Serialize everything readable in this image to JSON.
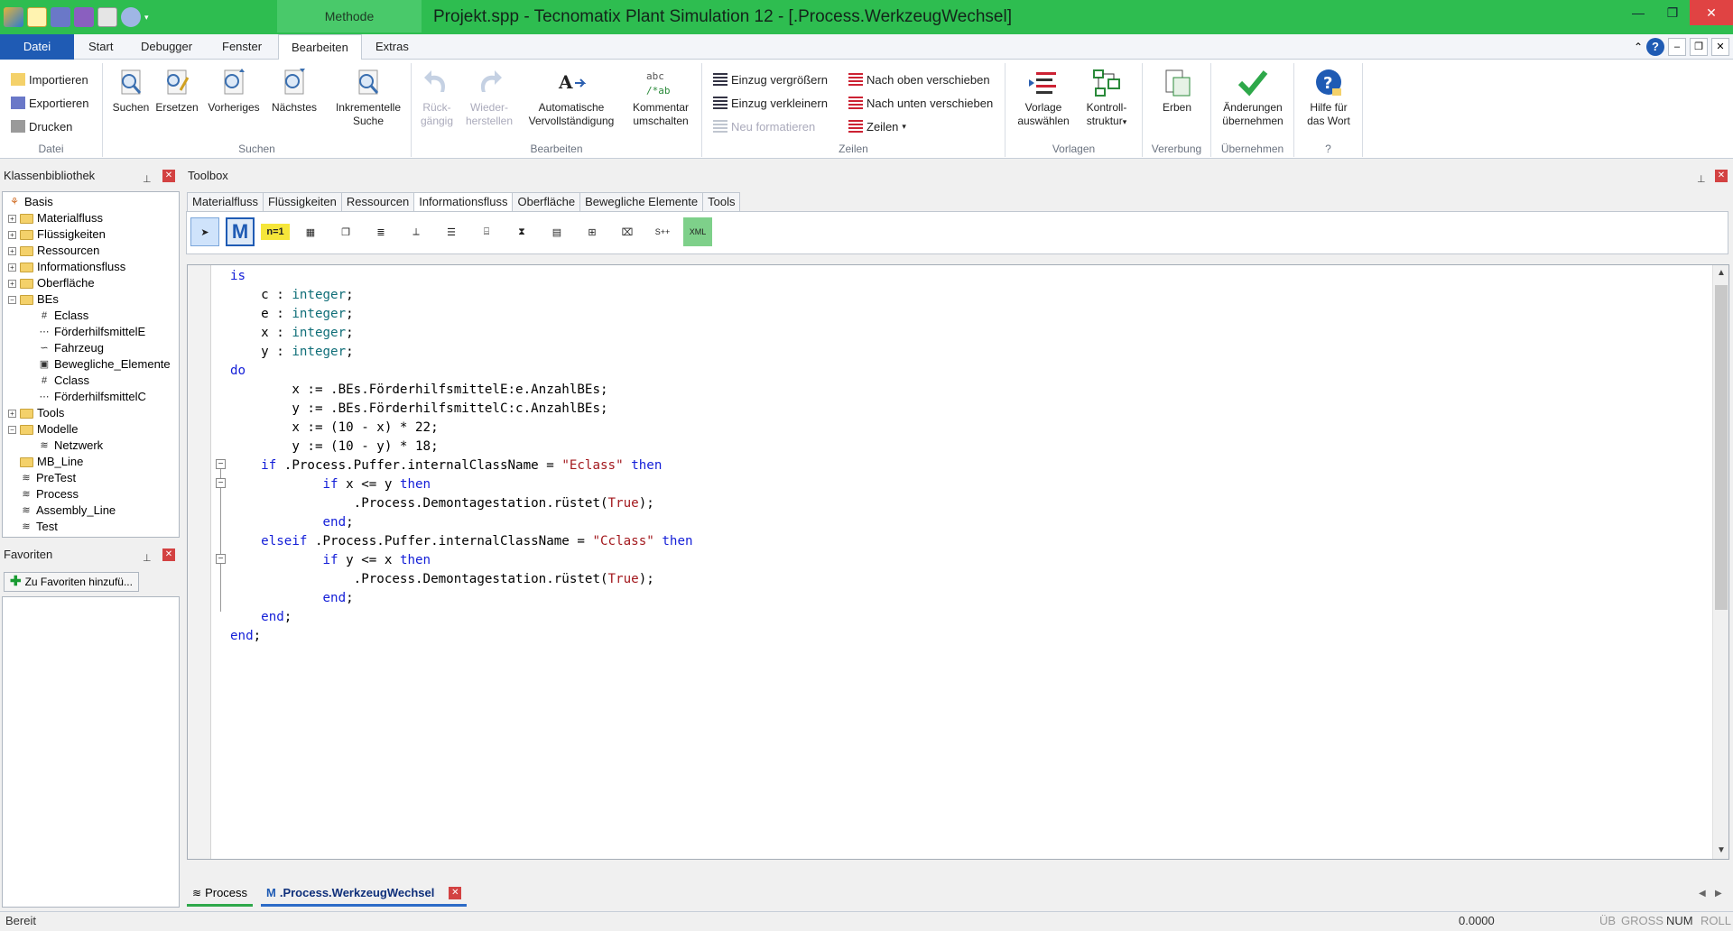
{
  "window": {
    "title": "Projekt.spp - Tecnomatix Plant Simulation 12 - [.Process.WerkzeugWechsel]",
    "contextual_tab": "Methode"
  },
  "ribbon_tabs": [
    "Datei",
    "Start",
    "Debugger",
    "Fenster",
    "Bearbeiten",
    "Extras"
  ],
  "active_tab": "Bearbeiten",
  "groups": {
    "datei": {
      "label": "Datei",
      "items": [
        "Importieren",
        "Exportieren",
        "Drucken"
      ]
    },
    "suchen": {
      "label": "Suchen",
      "items": [
        "Suchen",
        "Ersetzen",
        "Vorheriges",
        "Nächstes"
      ],
      "inkrementelle_1": "Inkrementelle",
      "inkrementelle_2": "Suche"
    },
    "bearbeiten": {
      "label": "Bearbeiten",
      "undo_1": "Rück-",
      "undo_2": "gängig",
      "redo_1": "Wieder-",
      "redo_2": "herstellen",
      "auto_1": "Automatische",
      "auto_2": "Vervollständigung",
      "comment_1": "Kommentar",
      "comment_2": "umschalten",
      "comment_icon_1": "abc",
      "comment_icon_2": "/*ab"
    },
    "zeilen": {
      "label": "Zeilen",
      "einzug_gross": "Einzug vergrößern",
      "einzug_klein": "Einzug verkleinern",
      "neu_format": "Neu formatieren",
      "nach_oben": "Nach oben verschieben",
      "nach_unten": "Nach unten verschieben",
      "zeilen_menu": "Zeilen"
    },
    "vorlagen": {
      "label": "Vorlagen",
      "vorlage_1": "Vorlage",
      "vorlage_2": "auswählen",
      "kontroll_1": "Kontroll-",
      "kontroll_2": "struktur"
    },
    "vererbung": {
      "label": "Vererbung",
      "erben": "Erben"
    },
    "uebernehmen": {
      "label": "Übernehmen",
      "aend_1": "Änderungen",
      "aend_2": "übernehmen"
    },
    "hilfe": {
      "label": "?",
      "hilfe_1": "Hilfe für",
      "hilfe_2": "das Wort"
    }
  },
  "classlib": {
    "title": "Klassenbibliothek",
    "nodes": [
      "Basis",
      "Materialfluss",
      "Flüssigkeiten",
      "Ressourcen",
      "Informationsfluss",
      "Oberfläche",
      "BEs",
      "Eclass",
      "FörderhilfsmittelE",
      "Fahrzeug",
      "Bewegliche_Elemente",
      "Cclass",
      "FörderhilfsmittelC",
      "Tools",
      "Modelle",
      "Netzwerk",
      "MB_Line",
      "PreTest",
      "Process",
      "Assembly_Line",
      "Test"
    ]
  },
  "favorites": {
    "title": "Favoriten",
    "add_button": "Zu Favoriten hinzufü..."
  },
  "toolbox": {
    "title": "Toolbox",
    "tabs": [
      "Materialfluss",
      "Flüssigkeiten",
      "Ressourcen",
      "Informationsfluss",
      "Oberfläche",
      "Bewegliche Elemente",
      "Tools"
    ],
    "active_tab": "Informationsfluss",
    "icons": [
      "pointer-icon",
      "method-icon",
      "variable-icon",
      "table-icon",
      "stack-table-icon",
      "queue-icon",
      "trigger-icon",
      "list-icon",
      "chart-icon",
      "generator-icon",
      "interface-icon",
      "dde-icon",
      "socket-icon",
      "sql-icon",
      "xml-icon"
    ],
    "icon_text": {
      "method": "M",
      "variable": "n=1"
    }
  },
  "code": [
    "is",
    "    c : integer;",
    "    e : integer;",
    "    x : integer;",
    "    y : integer;",
    "do",
    "        x := .BEs.FörderhilfsmittelE:e.AnzahlBEs;",
    "        y := .BEs.FörderhilfsmittelC:c.AnzahlBEs;",
    "        x := (10 - x) * 22;",
    "        y := (10 - y) * 18;",
    "    if .Process.Puffer.internalClassName = \"Eclass\" then",
    "            if x <= y then",
    "                .Process.Demontagestation.rüstet(True);",
    "            end;",
    "    elseif .Process.Puffer.internalClassName = \"Cclass\" then",
    "            if y <= x then",
    "                .Process.Demontagestation.rüstet(True);",
    "            end;",
    "    end;",
    "end;"
  ],
  "doc_tabs": [
    {
      "label": "Process",
      "active": false
    },
    {
      "label": ".Process.WerkzeugWechsel",
      "active": true
    }
  ],
  "status": {
    "left": "Bereit",
    "value": "0.0000",
    "indicators": [
      "ÜB",
      "GROSS",
      "NUM",
      "ROLL"
    ]
  },
  "colors": {
    "title_bar": "#2ebd50",
    "keyword": "#1520d8",
    "type": "#0f6e78",
    "string": "#a3191e",
    "file_tab": "#1f5bb4"
  }
}
